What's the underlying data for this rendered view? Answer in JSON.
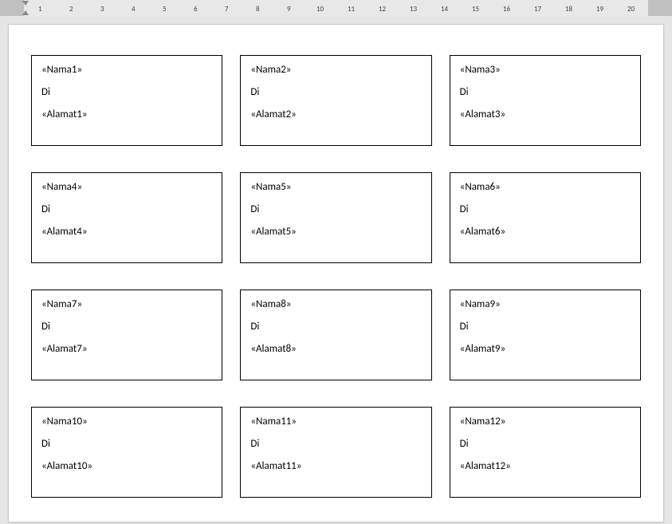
{
  "ruler": {
    "numbers": [
      1,
      2,
      3,
      4,
      5,
      6,
      7,
      8,
      9,
      10,
      11,
      12,
      13,
      14,
      15,
      16,
      17,
      18,
      19,
      20
    ]
  },
  "labels": [
    {
      "nama": "«Nama1»",
      "di": "Di",
      "alamat": "«Alamat1»"
    },
    {
      "nama": "«Nama2»",
      "di": "Di",
      "alamat": "«Alamat2»"
    },
    {
      "nama": "«Nama3»",
      "di": "Di",
      "alamat": "«Alamat3»"
    },
    {
      "nama": "«Nama4»",
      "di": "Di",
      "alamat": "«Alamat4»"
    },
    {
      "nama": "«Nama5»",
      "di": "Di",
      "alamat": "«Alamat5»"
    },
    {
      "nama": "«Nama6»",
      "di": "Di",
      "alamat": "«Alamat6»"
    },
    {
      "nama": "«Nama7»",
      "di": "Di",
      "alamat": "«Alamat7»"
    },
    {
      "nama": "«Nama8»",
      "di": "Di",
      "alamat": "«Alamat8»"
    },
    {
      "nama": "«Nama9»",
      "di": "Di",
      "alamat": "«Alamat9»"
    },
    {
      "nama": "«Nama10»",
      "di": "Di",
      "alamat": "«Alamat10»"
    },
    {
      "nama": "«Nama11»",
      "di": "Di",
      "alamat": "«Alamat11»"
    },
    {
      "nama": "«Nama12»",
      "di": "Di",
      "alamat": "«Alamat12»"
    }
  ]
}
